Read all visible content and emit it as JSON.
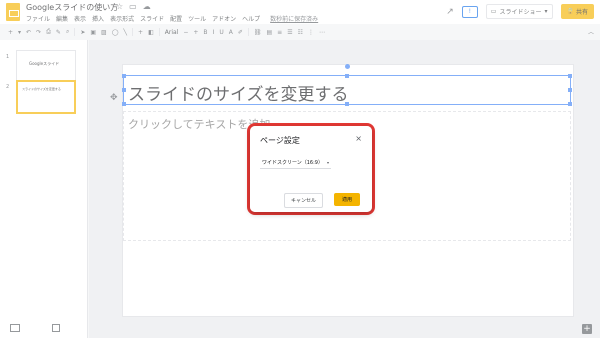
{
  "app": {
    "title": "Googleスライドの使い方",
    "menu": [
      "ファイル",
      "編集",
      "表示",
      "挿入",
      "表示形式",
      "スライド",
      "配置",
      "ツール",
      "アドオン",
      "ヘルプ"
    ],
    "last_edit": "数秒前に保存済み"
  },
  "header": {
    "comment_label": "!",
    "slideshow_label": "スライドショー",
    "share_label": "共有"
  },
  "toolbar": {
    "font_name": "Arial",
    "icons": [
      "add-icon",
      "undo-icon",
      "redo-icon",
      "print-icon",
      "paint-format-icon",
      "zoom-icon",
      "cursor-icon",
      "select-icon",
      "image-icon",
      "shape-icon",
      "line-icon",
      "bold-icon",
      "italic-icon",
      "underline-icon",
      "text-color-icon",
      "link-icon",
      "comment-icon",
      "align-icon",
      "list-icon",
      "more-icon"
    ]
  },
  "filmstrip": {
    "slides": [
      {
        "number": "1",
        "text": "Googleスライド"
      },
      {
        "number": "2",
        "text": "スライドのサイズを変更する"
      }
    ]
  },
  "slide": {
    "title": "スライドのサイズを変更する",
    "body_placeholder": "クリックしてテキストを追加"
  },
  "dialog": {
    "title": "ページ設定",
    "size_value": "ワイドスクリーン（16:9）",
    "cancel_label": "キャンセル",
    "apply_label": "適用"
  },
  "colors": {
    "accent": "#f4b400",
    "selection": "#4285f4",
    "highlight": "#e53935"
  }
}
